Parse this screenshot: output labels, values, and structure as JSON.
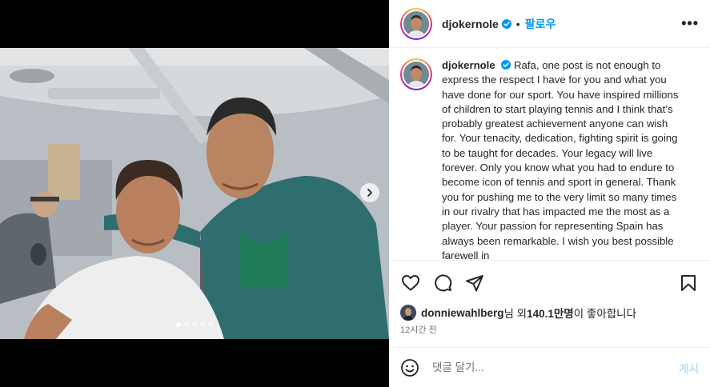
{
  "post": {
    "username": "djokernole",
    "follow_label": "팔로우",
    "more_label": "•••",
    "caption": "Rafa, one post is not enough to express the respect I have for you and what you have done for our sport. You have inspired millions of children to start playing tennis and I think that’s probably greatest achievement anyone can wish for. Your tenacity, dedication, fighting spirit is going to be taught for decades. Your legacy will live forever. Only you know what you had to endure to become icon of tennis and sport in general. Thank you for pushing me to the very limit so many times in our rivalry that has impacted me the most as a player. Your passion for representing Spain has always been remarkable. I wish you best possible farewell in",
    "carousel": {
      "total": 5,
      "active_index": 0
    }
  },
  "likes": {
    "user": "donniewahlberg",
    "mid": "님 외 ",
    "count": "140.1만명",
    "suffix": "이 좋아합니다"
  },
  "timestamp": "12시간 전",
  "comment": {
    "placeholder": "댓글 달기...",
    "post_label": "게시"
  },
  "colors": {
    "link_blue": "#0095f6",
    "post_disabled": "#b2dffc",
    "verified_blue": "#0095f6"
  },
  "icons": {
    "like": "heart-icon",
    "comment": "comment-icon",
    "share": "share-icon",
    "save": "bookmark-icon",
    "emoji": "smile-icon",
    "next": "chevron-right-icon"
  }
}
